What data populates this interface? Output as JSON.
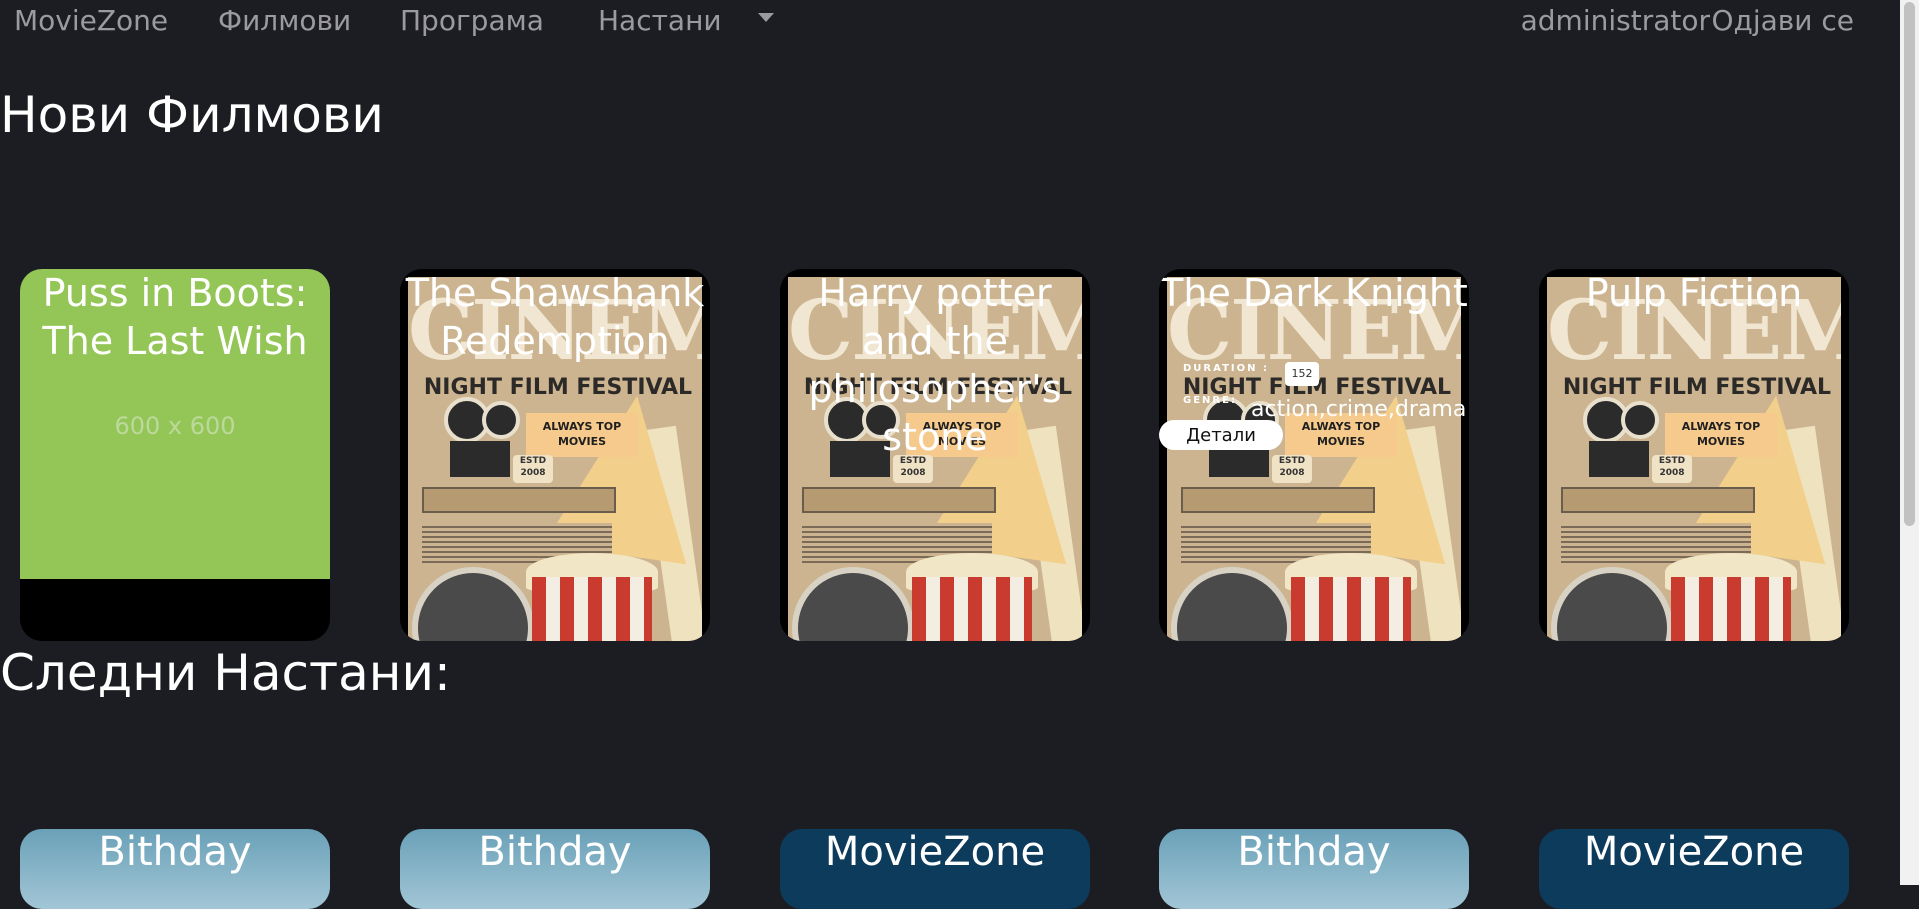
{
  "nav": {
    "brand": "MovieZone",
    "films": "Филмови",
    "program": "Програма",
    "events": "Настани",
    "user": "administrator",
    "logout": "Одјави се"
  },
  "sections": {
    "new_movies": "Нови Филмови",
    "next_events": "Следни Настани:"
  },
  "movies": [
    {
      "title": "Puss in Boots: The Last Wish",
      "placeholder_text": "600 x 600"
    },
    {
      "title": "The ShawshankRedemption"
    },
    {
      "title": "Harry potter and the philosopher's stone"
    },
    {
      "title": "The Dark Knight",
      "duration_label": "DURATION :",
      "duration": "152",
      "genre_label": "GENRE:",
      "genre": "action,crime,drama",
      "details_label": "Детали"
    },
    {
      "title": "Pulp Fiction"
    }
  ],
  "poster": {
    "cinema": "CINEMA",
    "festival": "NIGHT FILM FESTIVAL",
    "always": "ALWAYS TOP MOVIES",
    "est": "ESTD 2008"
  },
  "events": [
    {
      "title": "Bithday"
    },
    {
      "title": "Bithday"
    },
    {
      "title": "MovieZone"
    },
    {
      "title": "Bithday"
    },
    {
      "title": "MovieZone"
    }
  ]
}
